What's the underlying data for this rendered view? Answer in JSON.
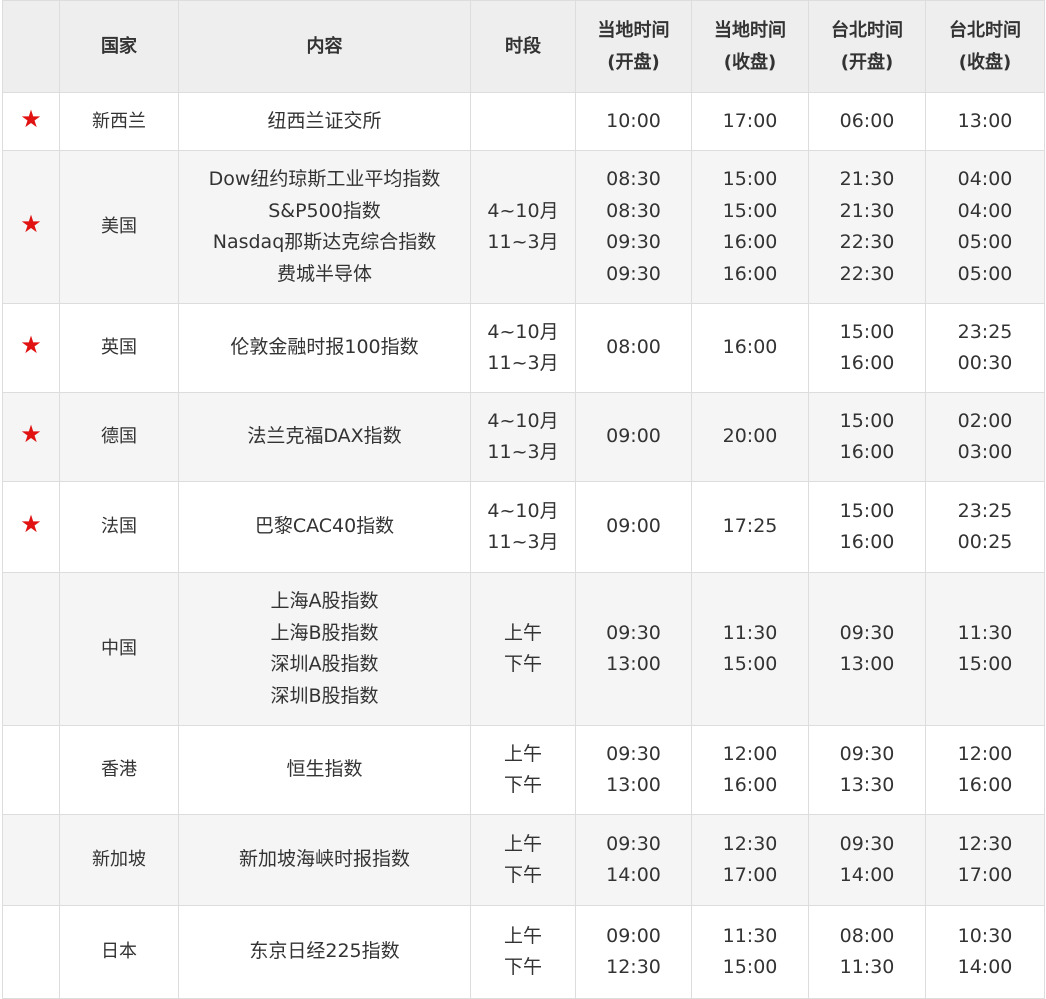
{
  "headers": {
    "mark": "",
    "country": "国家",
    "content": "内容",
    "period": "时段",
    "local_open": [
      "当地时间",
      "(开盘)"
    ],
    "local_close": [
      "当地时间",
      "(收盘)"
    ],
    "taipei_open": [
      "台北时间",
      "(开盘)"
    ],
    "taipei_close": [
      "台北时间",
      "(收盘)"
    ]
  },
  "star_glyph": "★",
  "star_color": "#e01212",
  "rows": [
    {
      "starred": true,
      "country": "新西兰",
      "content": [
        "纽西兰证交所"
      ],
      "period": [],
      "local_open": [
        "10:00"
      ],
      "local_close": [
        "17:00"
      ],
      "taipei_open": [
        "06:00"
      ],
      "taipei_close": [
        "13:00"
      ]
    },
    {
      "starred": true,
      "country": "美国",
      "content": [
        "Dow纽约琼斯工业平均指数",
        "S&P500指数",
        "Nasdaq那斯达克综合指数",
        "费城半导体"
      ],
      "period": [
        "4~10月",
        "11~3月"
      ],
      "local_open": [
        "08:30",
        "08:30",
        "09:30",
        "09:30"
      ],
      "local_close": [
        "15:00",
        "15:00",
        "16:00",
        "16:00"
      ],
      "taipei_open": [
        "21:30",
        "21:30",
        "22:30",
        "22:30"
      ],
      "taipei_close": [
        "04:00",
        "04:00",
        "05:00",
        "05:00"
      ]
    },
    {
      "starred": true,
      "country": "英国",
      "content": [
        "伦敦金融时报100指数"
      ],
      "period": [
        "4~10月",
        "11~3月"
      ],
      "local_open": [
        "08:00"
      ],
      "local_close": [
        "16:00"
      ],
      "taipei_open": [
        "15:00",
        "16:00"
      ],
      "taipei_close": [
        "23:25",
        "00:30"
      ]
    },
    {
      "starred": true,
      "country": "德国",
      "content": [
        "法兰克福DAX指数"
      ],
      "period": [
        "4~10月",
        "11~3月"
      ],
      "local_open": [
        "09:00"
      ],
      "local_close": [
        "20:00"
      ],
      "taipei_open": [
        "15:00",
        "16:00"
      ],
      "taipei_close": [
        "02:00",
        "03:00"
      ]
    },
    {
      "starred": true,
      "country": "法国",
      "content": [
        "巴黎CAC40指数"
      ],
      "period": [
        "4~10月",
        "11~3月"
      ],
      "local_open": [
        "09:00"
      ],
      "local_close": [
        "17:25"
      ],
      "taipei_open": [
        "15:00",
        "16:00"
      ],
      "taipei_close": [
        "23:25",
        "00:25"
      ]
    },
    {
      "starred": false,
      "country": "中国",
      "content": [
        "上海A股指数",
        "上海B股指数",
        "深圳A股指数",
        "深圳B股指数"
      ],
      "period": [
        "上午",
        "下午"
      ],
      "local_open": [
        "09:30",
        "13:00"
      ],
      "local_close": [
        "11:30",
        "15:00"
      ],
      "taipei_open": [
        "09:30",
        "13:00"
      ],
      "taipei_close": [
        "11:30",
        "15:00"
      ]
    },
    {
      "starred": false,
      "country": "香港",
      "content": [
        "恒生指数"
      ],
      "period": [
        "上午",
        "下午"
      ],
      "local_open": [
        "09:30",
        "13:00"
      ],
      "local_close": [
        "12:00",
        "16:00"
      ],
      "taipei_open": [
        "09:30",
        "13:30"
      ],
      "taipei_close": [
        "12:00",
        "16:00"
      ]
    },
    {
      "starred": false,
      "country": "新加坡",
      "content": [
        "新加坡海峡时报指数"
      ],
      "period": [
        "上午",
        "下午"
      ],
      "local_open": [
        "09:30",
        "14:00"
      ],
      "local_close": [
        "12:30",
        "17:00"
      ],
      "taipei_open": [
        "09:30",
        "14:00"
      ],
      "taipei_close": [
        "12:30",
        "17:00"
      ]
    },
    {
      "starred": false,
      "country": "日本",
      "content": [
        "东京日经225指数"
      ],
      "period": [
        "上午",
        "下午"
      ],
      "local_open": [
        "09:00",
        "12:30"
      ],
      "local_close": [
        "11:30",
        "15:00"
      ],
      "taipei_open": [
        "08:00",
        "11:30"
      ],
      "taipei_close": [
        "10:30",
        "14:00"
      ]
    }
  ]
}
